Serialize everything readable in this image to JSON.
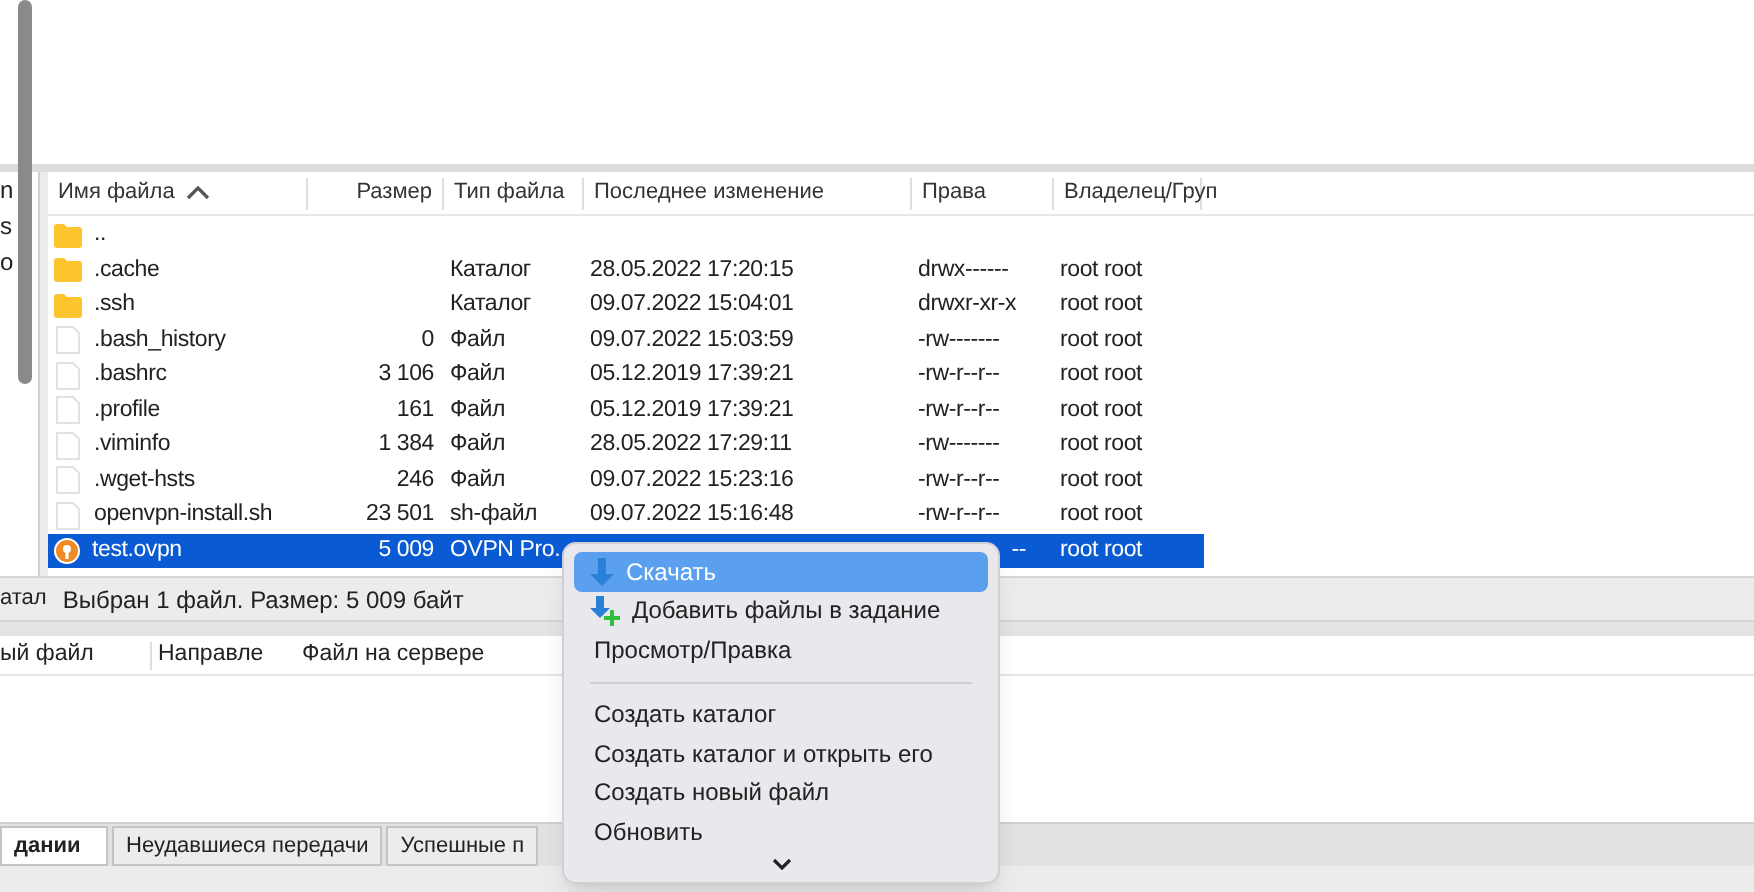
{
  "left_panel": {
    "fragments": [
      "n",
      "s",
      "o"
    ],
    "status": "атал"
  },
  "file_list": {
    "columns": [
      {
        "label": "Имя файла",
        "sorted": true
      },
      {
        "label": "Размер",
        "sorted": false
      },
      {
        "label": "Тип файла",
        "sorted": false
      },
      {
        "label": "Последнее изменение",
        "sorted": false
      },
      {
        "label": "Права",
        "sorted": false
      },
      {
        "label": "Владелец/Груп",
        "sorted": false
      }
    ],
    "rows": [
      {
        "name": "..",
        "kind": "folder",
        "size": "",
        "type": "",
        "modified": "",
        "rights": "",
        "owner": "",
        "selected": false
      },
      {
        "name": ".cache",
        "kind": "folder",
        "size": "",
        "type": "Каталог",
        "modified": "28.05.2022 17:20:15",
        "rights": "drwx------",
        "owner": "root root",
        "selected": false
      },
      {
        "name": ".ssh",
        "kind": "folder",
        "size": "",
        "type": "Каталог",
        "modified": "09.07.2022 15:04:01",
        "rights": "drwxr-xr-x",
        "owner": "root root",
        "selected": false
      },
      {
        "name": ".bash_history",
        "kind": "file",
        "size": "0",
        "type": "Файл",
        "modified": "09.07.2022 15:03:59",
        "rights": "-rw-------",
        "owner": "root root",
        "selected": false
      },
      {
        "name": ".bashrc",
        "kind": "file",
        "size": "3 106",
        "type": "Файл",
        "modified": "05.12.2019 17:39:21",
        "rights": "-rw-r--r--",
        "owner": "root root",
        "selected": false
      },
      {
        "name": ".profile",
        "kind": "file",
        "size": "161",
        "type": "Файл",
        "modified": "05.12.2019 17:39:21",
        "rights": "-rw-r--r--",
        "owner": "root root",
        "selected": false
      },
      {
        "name": ".viminfo",
        "kind": "file",
        "size": "1 384",
        "type": "Файл",
        "modified": "28.05.2022 17:29:11",
        "rights": "-rw-------",
        "owner": "root root",
        "selected": false
      },
      {
        "name": ".wget-hsts",
        "kind": "file",
        "size": "246",
        "type": "Файл",
        "modified": "09.07.2022 15:23:16",
        "rights": "-rw-r--r--",
        "owner": "root root",
        "selected": false
      },
      {
        "name": "openvpn-install.sh",
        "kind": "file",
        "size": "23 501",
        "type": "sh-файл",
        "modified": "09.07.2022 15:16:48",
        "rights": "-rw-r--r--",
        "owner": "root root",
        "selected": false
      },
      {
        "name": "test.ovpn",
        "kind": "ovpn",
        "size": "5 009",
        "type": "OVPN Pro.",
        "modified": "",
        "rights": "--",
        "owner": "root root",
        "selected": true
      }
    ]
  },
  "status": "Выбран 1 файл. Размер: 5 009 байт",
  "queue": {
    "columns": [
      "ый файл",
      "Направле",
      "Файл на сервере"
    ]
  },
  "tabs": [
    {
      "label": "дании",
      "selected": true
    },
    {
      "label": "Неудавшиеся передачи",
      "selected": false
    },
    {
      "label": "Успешные п",
      "selected": false
    }
  ],
  "context_menu": {
    "items": [
      {
        "kind": "download",
        "label": "Скачать",
        "highlighted": true
      },
      {
        "kind": "enqueue",
        "label": "Добавить файлы в задание",
        "highlighted": false
      },
      {
        "kind": "plain",
        "label": "Просмотр/Правка",
        "highlighted": false
      },
      {
        "kind": "separator"
      },
      {
        "kind": "plain",
        "label": "Создать каталог",
        "highlighted": false
      },
      {
        "kind": "plain",
        "label": "Создать каталог и открыть его",
        "highlighted": false
      },
      {
        "kind": "plain",
        "label": "Создать новый файл",
        "highlighted": false
      },
      {
        "kind": "plain",
        "label": "Обновить",
        "highlighted": false
      },
      {
        "kind": "more"
      }
    ]
  }
}
